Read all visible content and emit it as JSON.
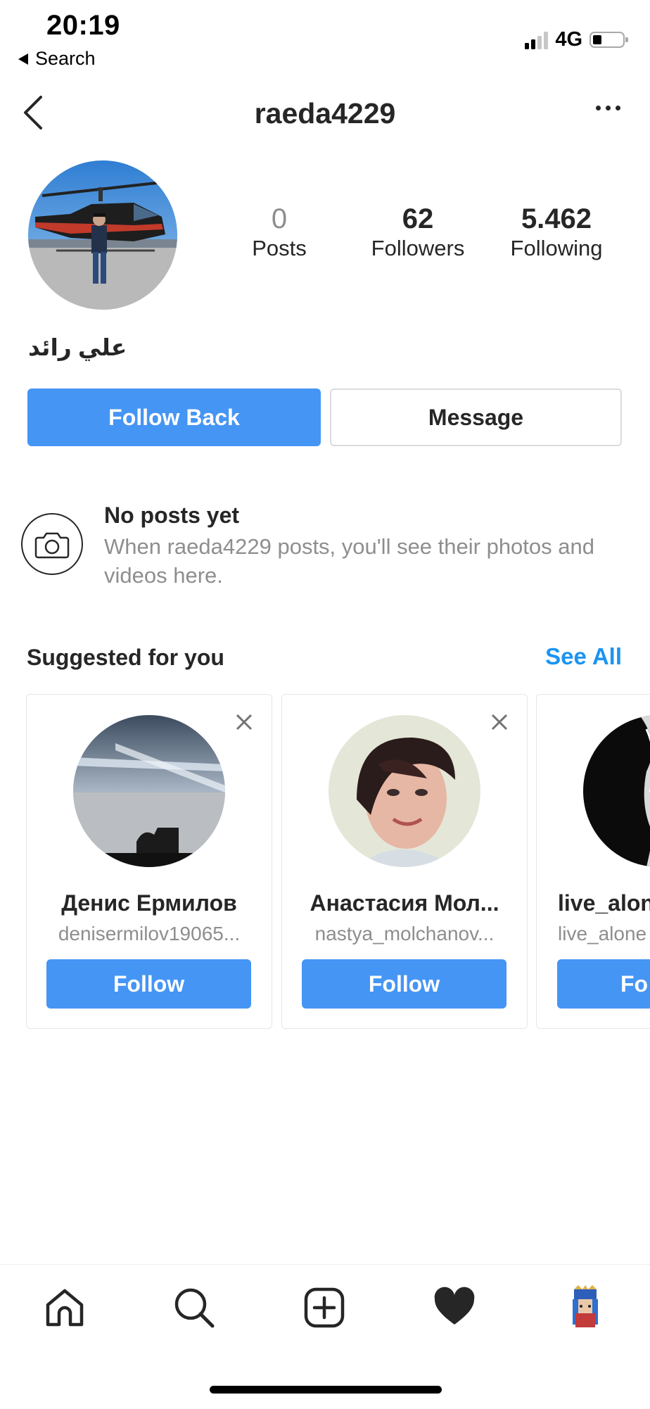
{
  "status_bar": {
    "time": "20:19",
    "back_label": "Search",
    "network": "4G",
    "signal_bars": 2,
    "battery_level": 0.3
  },
  "header": {
    "username": "raeda4229",
    "back_icon": "chevron-left-icon",
    "more_icon": "more-horizontal-icon"
  },
  "profile": {
    "full_name": "علي رائد",
    "stats": [
      {
        "count": "0",
        "label": "Posts"
      },
      {
        "count": "62",
        "label": "Followers"
      },
      {
        "count": "5.462",
        "label": "Following"
      }
    ],
    "follow_back_label": "Follow Back",
    "message_label": "Message"
  },
  "no_posts": {
    "title": "No posts yet",
    "description": "When raeda4229 posts, you'll see their photos and videos here."
  },
  "suggested": {
    "title": "Suggested for you",
    "see_all": "See All",
    "cards": [
      {
        "name": "Денис Ермилов",
        "username": "denisermilov19065...",
        "follow_label": "Follow"
      },
      {
        "name": "Анастасия Мол...",
        "username": "nastya_molchanov...",
        "follow_label": "Follow"
      },
      {
        "name": "live_alon",
        "username": "live_alone",
        "follow_label": "Fo"
      }
    ]
  },
  "tab_bar": {
    "items": [
      "home-icon",
      "search-icon",
      "new-post-icon",
      "activity-heart-icon",
      "profile-avatar-icon"
    ]
  },
  "colors": {
    "primary_blue": "#4595f5",
    "link_blue": "#1b94f3",
    "text": "#262626",
    "secondary_text": "#8e8e8e",
    "border": "#dbdbdb"
  }
}
